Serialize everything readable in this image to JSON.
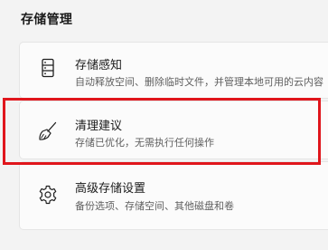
{
  "section": {
    "title": "存储管理"
  },
  "items": [
    {
      "title": "存储感知",
      "subtitle": "自动释放空间、删除临时文件，并管理本地可用的云内容",
      "icon": "storage-drive-icon"
    },
    {
      "title": "清理建议",
      "subtitle": "存储已优化，无需执行任何操作",
      "icon": "broom-icon"
    },
    {
      "title": "高级存储设置",
      "subtitle": "备份选项、存储空间、其他磁盘和卷",
      "icon": "gear-icon"
    }
  ],
  "colors": {
    "background": "#f3f3f3",
    "card": "#fbfbfb",
    "highlight": "#e0161c"
  }
}
